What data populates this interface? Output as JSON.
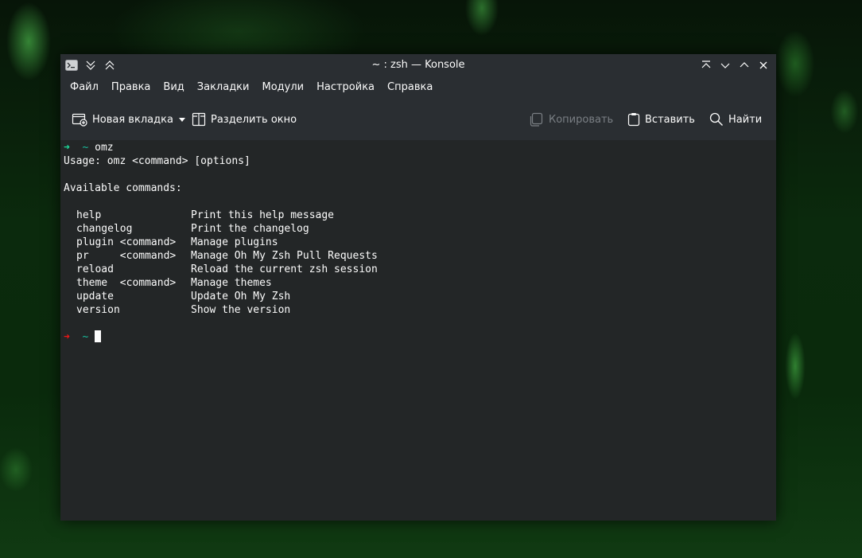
{
  "window": {
    "title": "~ : zsh — Konsole"
  },
  "menubar": {
    "items": [
      "Файл",
      "Правка",
      "Вид",
      "Закладки",
      "Модули",
      "Настройка",
      "Справка"
    ]
  },
  "toolbar": {
    "new_tab": "Новая вкладка",
    "split_view": "Разделить окно",
    "copy": "Копировать",
    "paste": "Вставить",
    "find": "Найти"
  },
  "terminal": {
    "prompt_arrow": "➜",
    "prompt_dir": "~",
    "entered_command": "omz",
    "usage_line": "Usage: omz <command> [options]",
    "available_header": "Available commands:",
    "commands": [
      {
        "name": "help",
        "desc": "Print this help message"
      },
      {
        "name": "changelog",
        "desc": "Print the changelog"
      },
      {
        "name": "plugin <command>",
        "desc": "Manage plugins"
      },
      {
        "name": "pr     <command>",
        "desc": "Manage Oh My Zsh Pull Requests"
      },
      {
        "name": "reload",
        "desc": "Reload the current zsh session"
      },
      {
        "name": "theme  <command>",
        "desc": "Manage themes"
      },
      {
        "name": "update",
        "desc": "Update Oh My Zsh"
      },
      {
        "name": "version",
        "desc": "Show the version"
      }
    ]
  },
  "colors": {
    "prompt_ok": "#1cdc9a",
    "prompt_error": "#ed1515",
    "terminal_bg": "#232627",
    "chrome_bg": "#2a2e32"
  },
  "icons": {
    "app": "konsole-terminal-icon",
    "new_tab": "new-tab-icon",
    "split": "split-view-icon",
    "copy": "copy-icon",
    "paste": "paste-icon",
    "find": "search-icon"
  }
}
